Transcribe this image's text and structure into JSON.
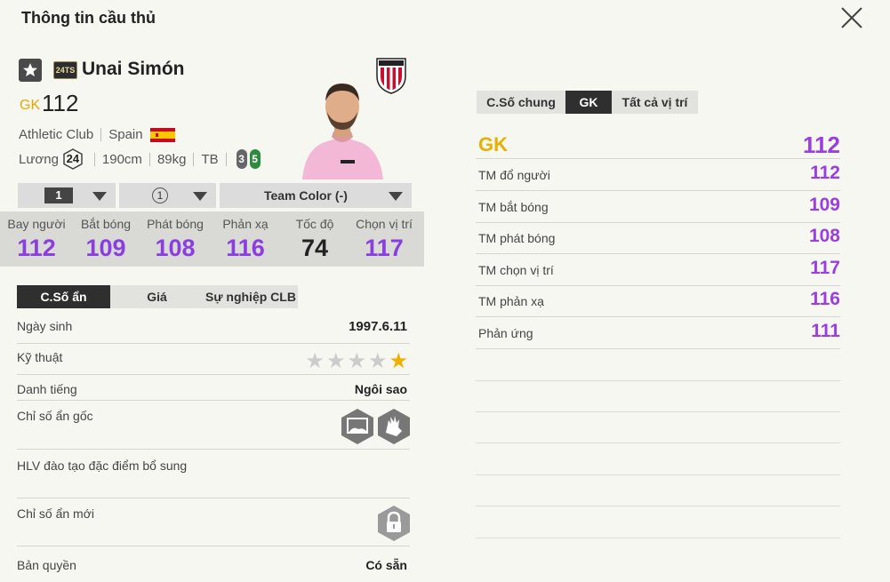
{
  "header": {
    "title": "Thông tin cầu thủ"
  },
  "player": {
    "season_badge": "24TS",
    "name": "Unai Simón",
    "position": "GK",
    "overall": "112",
    "club": "Athletic Club",
    "nation": "Spain",
    "wage_label": "Lương",
    "wage": "24",
    "height": "190cm",
    "weight": "89kg",
    "body_type": "TB",
    "weak_foot_left": "3",
    "weak_foot_right": "5"
  },
  "selectors": {
    "level": "1",
    "upgrade": "1",
    "team_color": "Team Color (-)"
  },
  "stats": [
    {
      "label": "Bay người",
      "value": "112"
    },
    {
      "label": "Bắt bóng",
      "value": "109"
    },
    {
      "label": "Phát bóng",
      "value": "108"
    },
    {
      "label": "Phản xạ",
      "value": "116"
    },
    {
      "label": "Tốc độ",
      "value": "74"
    },
    {
      "label": "Chọn vị trí",
      "value": "117"
    }
  ],
  "left_tabs": [
    "C.Số ẩn",
    "Giá",
    "Sự nghiệp CLB"
  ],
  "details": {
    "birthday_label": "Ngày sinh",
    "birthday": "1997.6.11",
    "skill_label": "Kỹ thuật",
    "skill_stars": 1,
    "fame_label": "Danh tiếng",
    "fame": "Ngôi sao",
    "hidden_traits_label": "Chỉ số ẩn gốc",
    "coach_traits_label": "HLV đào tạo đặc điểm bổ sung",
    "new_traits_label": "Chỉ số ẩn mới",
    "license_label": "Bản quyền",
    "license": "Có sẵn"
  },
  "right_tabs": [
    "C.Số chung",
    "GK",
    "Tất cả vị trí"
  ],
  "right_panel": {
    "header_label": "GK",
    "header_value": "112",
    "rows": [
      {
        "label": "TM đổ người",
        "value": "112"
      },
      {
        "label": "TM bắt bóng",
        "value": "109"
      },
      {
        "label": "TM phát bóng",
        "value": "108"
      },
      {
        "label": "TM chọn vị trí",
        "value": "117"
      },
      {
        "label": "TM phản xạ",
        "value": "116"
      },
      {
        "label": "Phản ứng",
        "value": "111"
      }
    ]
  },
  "colors": {
    "accent_purple": "#9a3ee0",
    "gold": "#e8a800",
    "dark": "#2f2f2f"
  },
  "icons": [
    "close-icon",
    "star-icon",
    "club-crest-icon",
    "spain-flag-icon",
    "wage-hex-icon",
    "dropdown-arrow-icon",
    "goal-trait-icon",
    "gloves-trait-icon",
    "lock-icon"
  ]
}
